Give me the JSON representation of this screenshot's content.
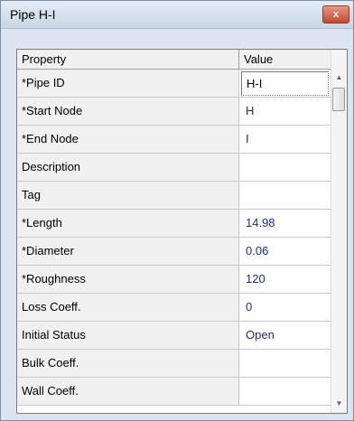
{
  "window": {
    "title": "Pipe H-I",
    "close_glyph": "x"
  },
  "grid": {
    "columns": {
      "property": "Property",
      "value": "Value"
    },
    "rows": [
      {
        "property": "*Pipe ID",
        "value": "H-I"
      },
      {
        "property": "*Start Node",
        "value": "H"
      },
      {
        "property": "*End Node",
        "value": "I"
      },
      {
        "property": "Description",
        "value": ""
      },
      {
        "property": "Tag",
        "value": ""
      },
      {
        "property": "*Length",
        "value": "14.98"
      },
      {
        "property": "*Diameter",
        "value": "0.06"
      },
      {
        "property": "*Roughness",
        "value": "120"
      },
      {
        "property": "Loss Coeff.",
        "value": "0"
      },
      {
        "property": "Initial Status",
        "value": "Open"
      },
      {
        "property": "Bulk Coeff.",
        "value": ""
      },
      {
        "property": "Wall Coeff.",
        "value": ""
      }
    ]
  },
  "scrollbar": {
    "up_glyph": "▲",
    "down_glyph": "▼"
  },
  "colors": {
    "value_text": "#1a2a9c",
    "property_cell_bg": "#f0f0f0",
    "window_frame": "#dbe4ef"
  }
}
